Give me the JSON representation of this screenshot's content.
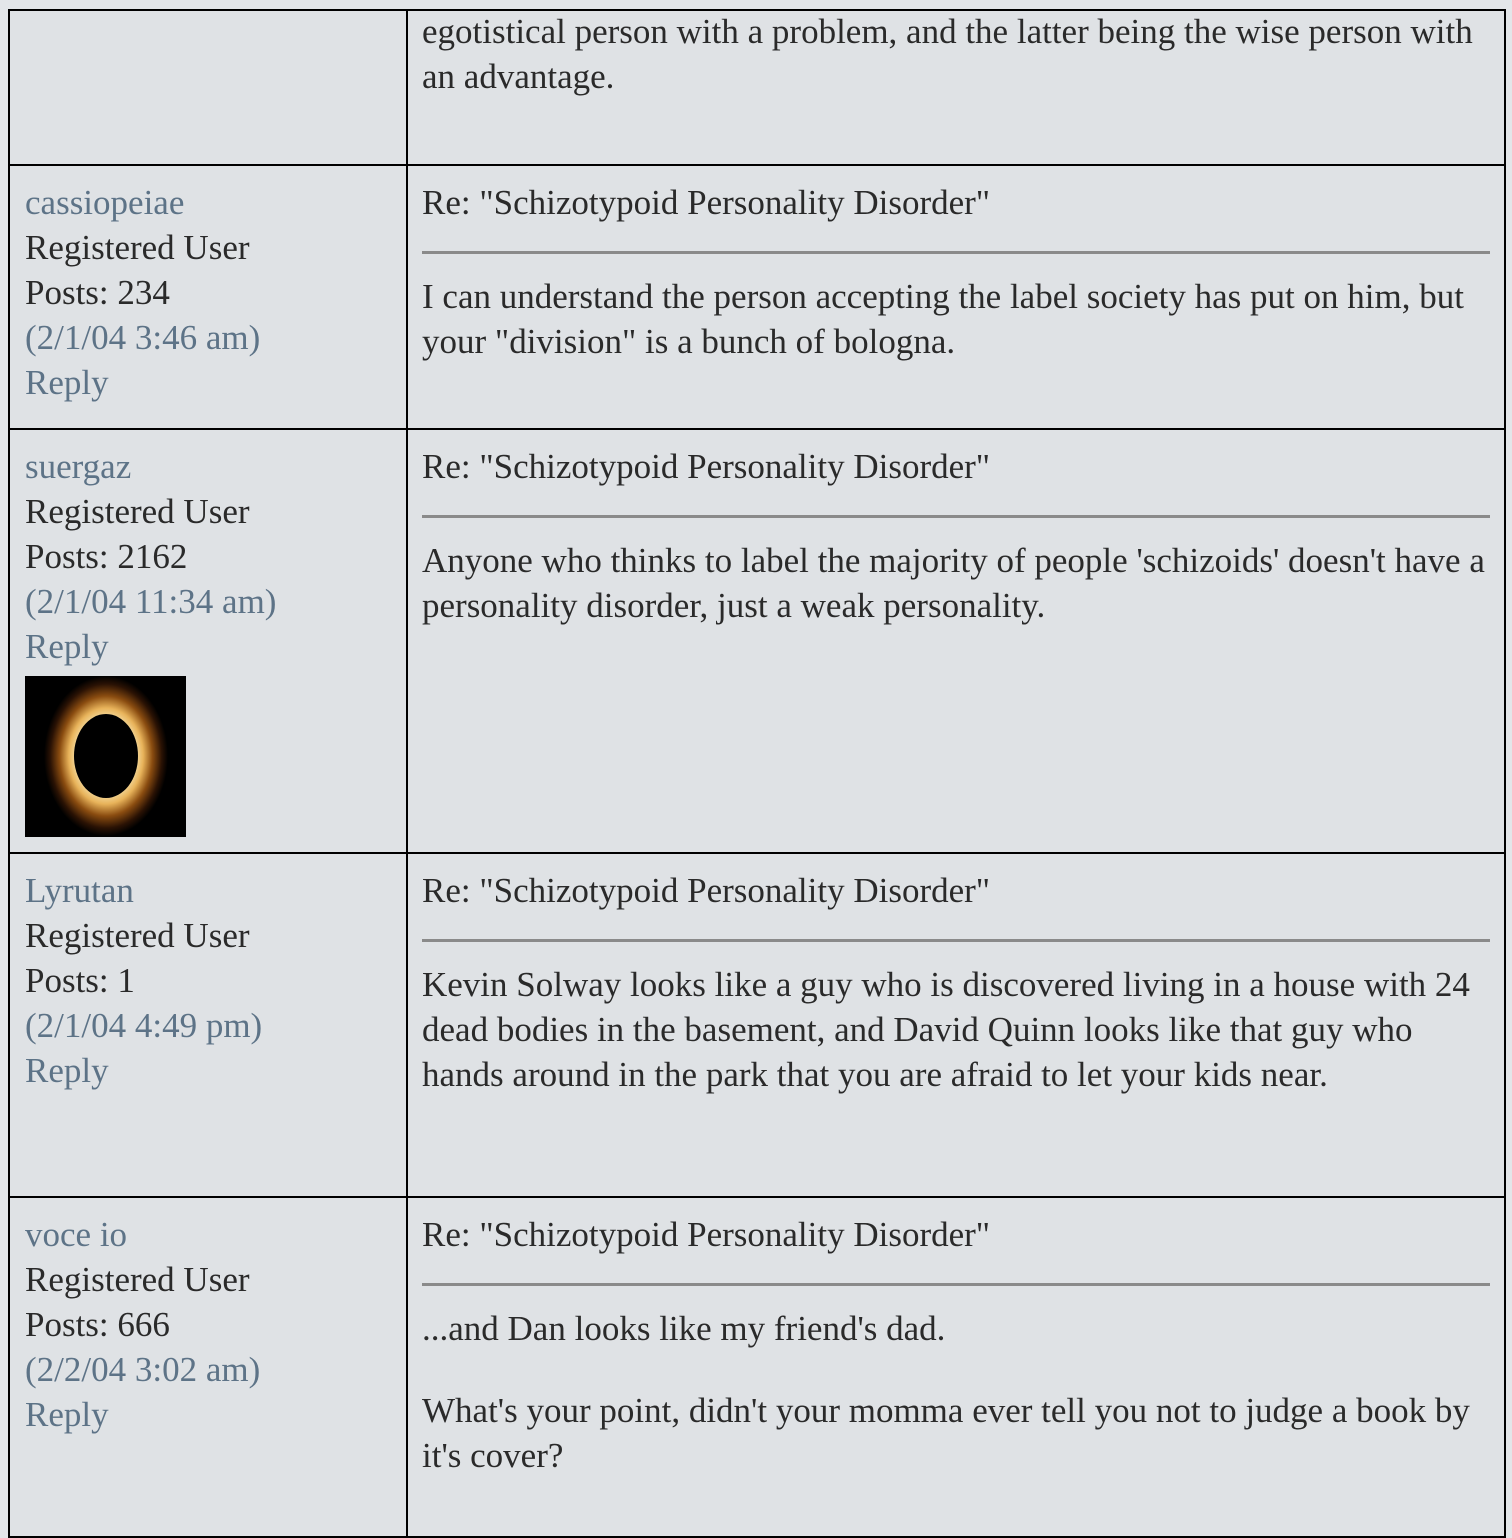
{
  "prev_post": {
    "body_fragment": "egotistical person with a problem, and the latter being the wise person with an advantage."
  },
  "posts": [
    {
      "username": "cassiopeiae",
      "role": "Registered User",
      "posts_count": "Posts: 234",
      "timestamp": "(2/1/04 3:46 am)",
      "reply_label": "Reply",
      "subject": "Re: \"Schizotypoid Personality Disorder\"",
      "body": [
        "I can understand the person accepting the label society has put on him, but your \"division\" is a bunch of bologna."
      ]
    },
    {
      "username": "suergaz",
      "role": "Registered User",
      "posts_count": "Posts: 2162",
      "timestamp": "(2/1/04 11:34 am)",
      "reply_label": "Reply",
      "avatar_icon": "solar-eclipse-avatar",
      "subject": "Re: \"Schizotypoid Personality Disorder\"",
      "body": [
        "Anyone who thinks to label the majority of people 'schizoids' doesn't have a personality disorder, just a weak personality."
      ]
    },
    {
      "username": "Lyrutan",
      "role": "Registered User",
      "posts_count": "Posts: 1",
      "timestamp": "(2/1/04 4:49 pm)",
      "reply_label": "Reply",
      "subject": "Re: \"Schizotypoid Personality Disorder\"",
      "body": [
        "Kevin Solway looks like a guy who is discovered living in a house with 24 dead bodies in the basement, and David Quinn looks like that guy who hands around in the park that you are afraid to let your kids near."
      ]
    },
    {
      "username": "voce io",
      "role": "Registered User",
      "posts_count": "Posts: 666",
      "timestamp": "(2/2/04 3:02 am)",
      "reply_label": "Reply",
      "subject": "Re: \"Schizotypoid Personality Disorder\"",
      "body": [
        "...and Dan looks like my friend's dad.",
        "What's your point, didn't your momma ever tell you not to judge a book by it's cover?"
      ]
    }
  ],
  "colors": {
    "background": "#dfe2e5",
    "link": "#5d7387",
    "border": "#000000",
    "rule": "#8a8a8a"
  }
}
